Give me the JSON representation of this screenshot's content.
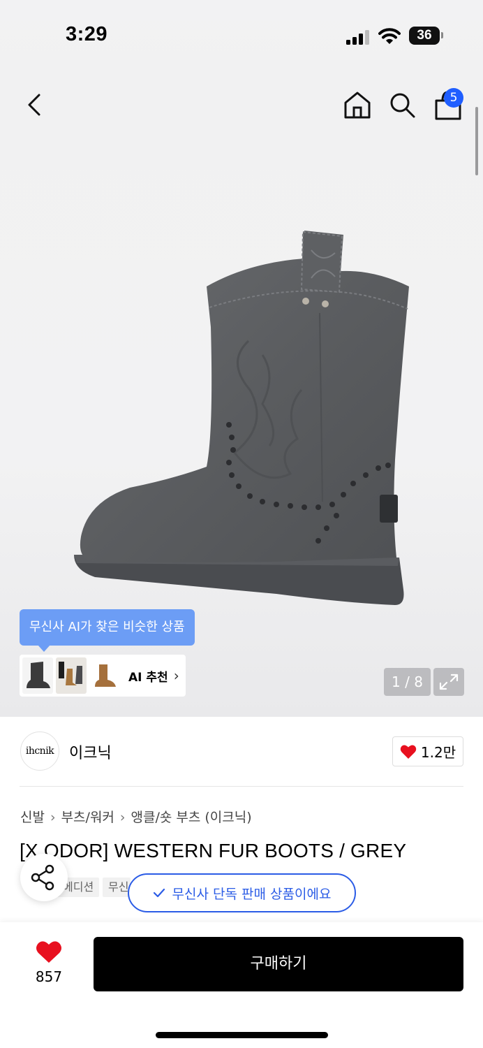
{
  "status_bar": {
    "time": "3:29",
    "battery": "36"
  },
  "header": {
    "cart_count": "5"
  },
  "gallery": {
    "ai_tooltip": "무신사 AI가 찾은 비슷한 상품",
    "ai_recommend_label": "AI 추천",
    "pager": "1 / 8"
  },
  "brand": {
    "logo_text": "ihcnik",
    "name": "이크닉",
    "likes": "1.2만"
  },
  "breadcrumb": [
    "신발",
    "부츠/워커",
    "앵클/숏 부츠 (이크닉)"
  ],
  "product": {
    "title": "[X ODOR] WESTERN FUR BOOTS / GREY",
    "tags": [
      "에디션",
      "무신"
    ],
    "exclusive_badge": "무신사 단독 판매 상품이에요"
  },
  "bottom_bar": {
    "wish_count": "857",
    "buy_label": "구매하기"
  },
  "colors": {
    "accent_blue": "#2b5ce6",
    "badge_blue": "#1f5eff",
    "tooltip_blue": "#6c9df5",
    "heart_red": "#e8101f"
  }
}
